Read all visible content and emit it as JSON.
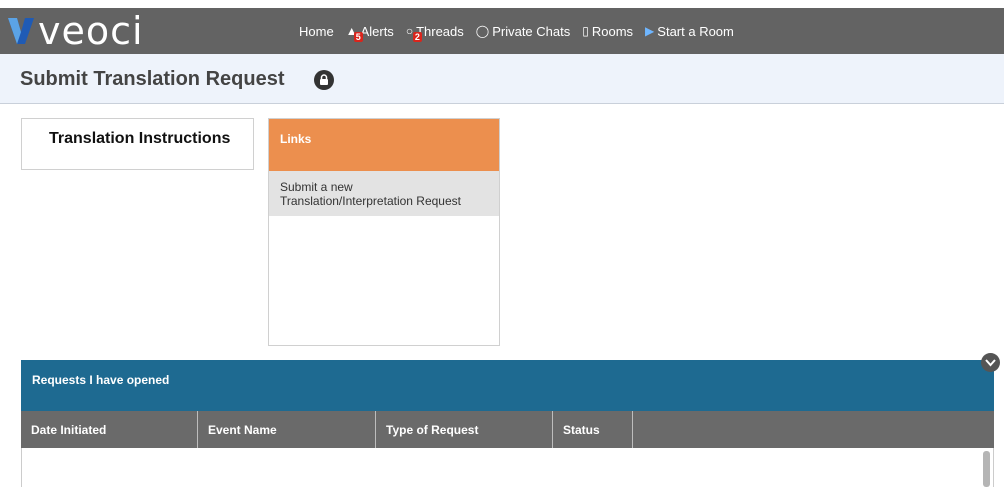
{
  "header": {
    "logo_text": "veoci",
    "nav": [
      {
        "label": "Home",
        "icon": ""
      },
      {
        "label": "Alerts",
        "icon": "alert-icon",
        "badge": "5"
      },
      {
        "label": "Threads",
        "icon": "threads-icon",
        "badge": "2"
      },
      {
        "label": "Private Chats",
        "icon": "chat-bubble-icon"
      },
      {
        "label": "Rooms",
        "icon": "rooms-icon"
      },
      {
        "label": "Start a Room",
        "icon": "play-icon"
      }
    ]
  },
  "page": {
    "title": "Submit Translation Request"
  },
  "instructions": {
    "label": "Translation Instructions"
  },
  "links": {
    "header": "Links",
    "item_line1": "Submit a new",
    "item_line2": "Translation/Interpretation Request"
  },
  "requests": {
    "header": "Requests I have opened",
    "columns": [
      "Date Initiated",
      "Event Name",
      "Type of Request",
      "Status"
    ]
  },
  "colors": {
    "topbar": "#636363",
    "links_header": "#ec8f4e",
    "requests_header": "#1e6a91",
    "badge": "#d9251c"
  }
}
